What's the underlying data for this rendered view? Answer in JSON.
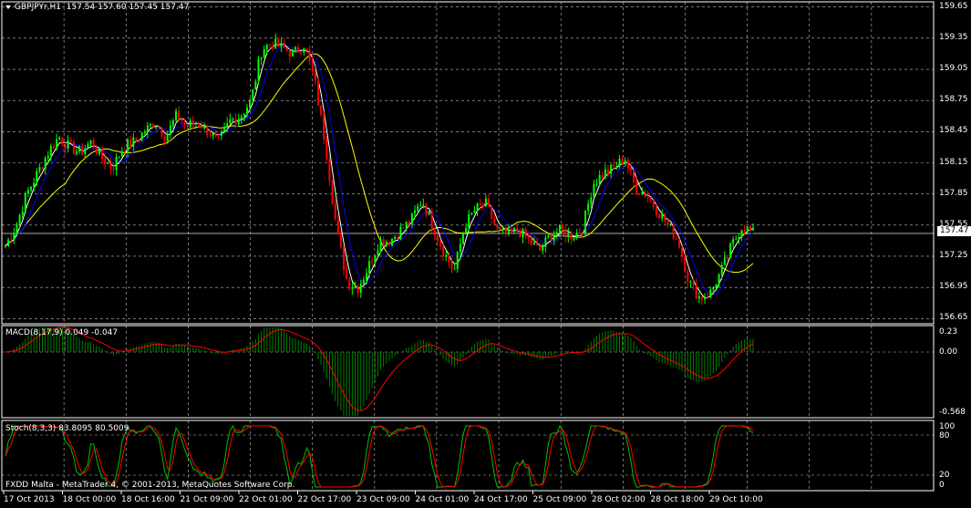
{
  "header": {
    "symbol": "GBPJPYr,H1",
    "ohlc": "157.54 157.60 157.45 157.47"
  },
  "price_axis": [
    "159.65",
    "159.35",
    "159.05",
    "158.75",
    "158.45",
    "158.15",
    "157.85",
    "157.55",
    "157.25",
    "156.95",
    "156.65"
  ],
  "current_price": "157.47",
  "macd": {
    "title": "MACD(8,17,9) 0.049 -0.047",
    "axis": [
      "0.23",
      "0.00",
      "-0.568"
    ]
  },
  "stoch": {
    "title": "Stoch(8,3,3) 83.8095 80.5009",
    "axis": [
      "100",
      "80",
      "20",
      "0"
    ]
  },
  "time_axis": [
    "17 Oct 2013",
    "18 Oct 00:00",
    "18 Oct 16:00",
    "21 Oct 09:00",
    "22 Oct 01:00",
    "22 Oct 17:00",
    "23 Oct 09:00",
    "24 Oct 01:00",
    "24 Oct 17:00",
    "25 Oct 09:00",
    "28 Oct 02:00",
    "28 Oct 18:00",
    "29 Oct 10:00"
  ],
  "footer": "FXDD Malta - MetaTrader 4, © 2001-2013, MetaQuotes Software Corp.",
  "colors": {
    "background": "#000000",
    "grid": "#c0c0c0",
    "bull": "#00ff00",
    "bear": "#ff0000",
    "ma_fast": "#ffffff",
    "ma_mid": "#0000ff",
    "ma_slow": "#ffff00",
    "macd_hist": "#008000",
    "macd_signal": "#ff0000"
  },
  "chart_data": {
    "type": "candlestick",
    "symbol": "GBPJPYr",
    "timeframe": "H1",
    "ylim": [
      156.6,
      159.7
    ],
    "close_path": [
      157.35,
      157.55,
      157.85,
      158.05,
      158.25,
      158.4,
      158.3,
      158.25,
      158.35,
      158.2,
      158.1,
      158.3,
      158.35,
      158.45,
      158.55,
      158.4,
      158.6,
      158.5,
      158.55,
      158.45,
      158.35,
      158.55,
      158.6,
      158.75,
      159.25,
      159.3,
      159.25,
      159.2,
      159.3,
      158.9,
      158.3,
      157.5,
      157.0,
      156.95,
      157.15,
      157.4,
      157.4,
      157.5,
      157.6,
      157.8,
      157.55,
      157.3,
      157.1,
      157.55,
      157.7,
      157.75,
      157.5,
      157.45,
      157.5,
      157.4,
      157.3,
      157.45,
      157.5,
      157.45,
      157.5,
      157.95,
      158.05,
      158.1,
      158.2,
      157.9,
      157.85,
      157.7,
      157.55,
      157.4,
      157.0,
      156.85,
      156.9,
      157.1,
      157.35,
      157.55,
      157.47
    ]
  }
}
